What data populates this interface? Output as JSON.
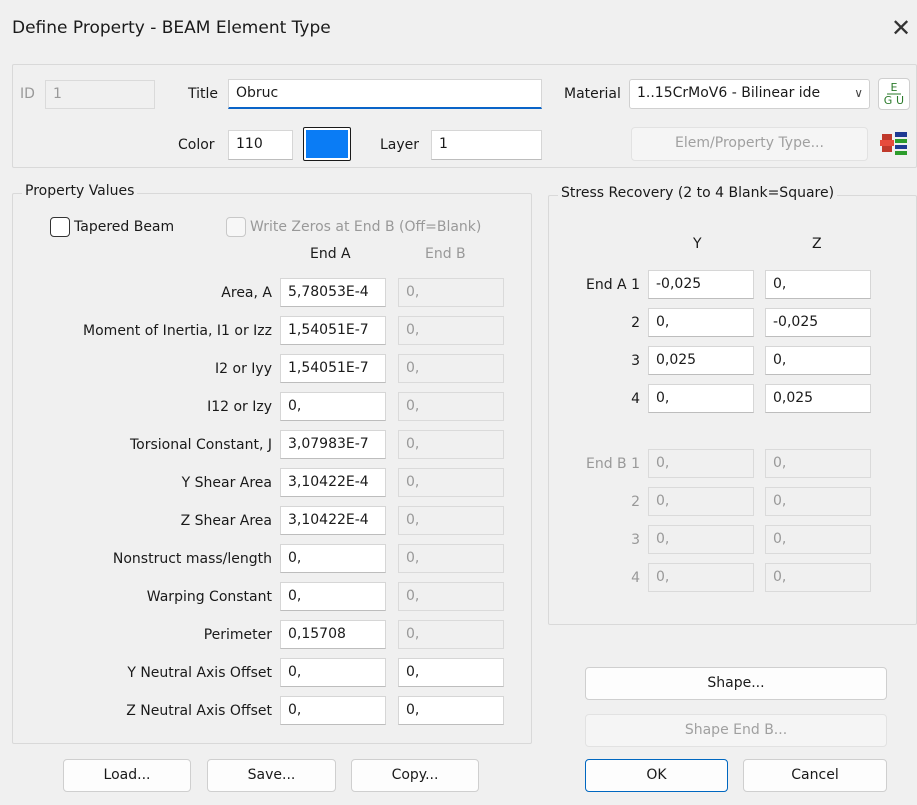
{
  "dialog": {
    "title": "Define Property - BEAM Element Type",
    "close_glyph": "✕"
  },
  "top": {
    "id_label": "ID",
    "id_value": "1",
    "title_label": "Title",
    "title_value": "Obruc",
    "material_label": "Material",
    "material_value": "1..15CrMoV6 - Bilinear idе",
    "color_label": "Color",
    "color_value": "110",
    "color_swatch": "#0a7cf5",
    "layer_label": "Layer",
    "layer_value": "1",
    "elem_type_button": "Elem/Property Type...",
    "gfu_icon": "EGU"
  },
  "property_values": {
    "legend": "Property Values",
    "tapered_label": "Tapered Beam",
    "write_zeros_label": "Write Zeros at End B (Off=Blank)",
    "end_a_header": "End A",
    "end_b_header": "End B",
    "rows": [
      {
        "label": "Area, A",
        "end_a": "5,78053E-4",
        "end_b": "0,"
      },
      {
        "label": "Moment of Inertia, I1 or Izz",
        "end_a": "1,54051E-7",
        "end_b": "0,"
      },
      {
        "label": "I2 or Iyy",
        "end_a": "1,54051E-7",
        "end_b": "0,"
      },
      {
        "label": "I12 or Izy",
        "end_a": "0,",
        "end_b": "0,"
      },
      {
        "label": "Torsional Constant, J",
        "end_a": "3,07983E-7",
        "end_b": "0,"
      },
      {
        "label": "Y Shear Area",
        "end_a": "3,10422E-4",
        "end_b": "0,"
      },
      {
        "label": "Z Shear Area",
        "end_a": "3,10422E-4",
        "end_b": "0,"
      },
      {
        "label": "Nonstruct mass/length",
        "end_a": "0,",
        "end_b": "0,"
      },
      {
        "label": "Warping Constant",
        "end_a": "0,",
        "end_b": "0,"
      },
      {
        "label": "Perimeter",
        "end_a": "0,15708",
        "end_b": "0,"
      },
      {
        "label": "Y Neutral Axis Offset",
        "end_a": "0,",
        "end_b": "0,"
      },
      {
        "label": "Z Neutral Axis Offset",
        "end_a": "0,",
        "end_b": "0,"
      }
    ]
  },
  "stress_recovery": {
    "legend": "Stress Recovery (2 to 4 Blank=Square)",
    "y_header": "Y",
    "z_header": "Z",
    "end_a_rows": [
      {
        "label": "End A 1",
        "y": "-0,025",
        "z": "0,"
      },
      {
        "label": "2",
        "y": "0,",
        "z": "-0,025"
      },
      {
        "label": "3",
        "y": "0,025",
        "z": "0,"
      },
      {
        "label": "4",
        "y": "0,",
        "z": "0,025"
      }
    ],
    "end_b_rows": [
      {
        "label": "End B 1",
        "y": "0,",
        "z": "0,"
      },
      {
        "label": "2",
        "y": "0,",
        "z": "0,"
      },
      {
        "label": "3",
        "y": "0,",
        "z": "0,"
      },
      {
        "label": "4",
        "y": "0,",
        "z": "0,"
      }
    ]
  },
  "buttons": {
    "shape": "Shape...",
    "shape_end_b": "Shape End B...",
    "load": "Load...",
    "save": "Save...",
    "copy": "Copy...",
    "ok": "OK",
    "cancel": "Cancel"
  }
}
